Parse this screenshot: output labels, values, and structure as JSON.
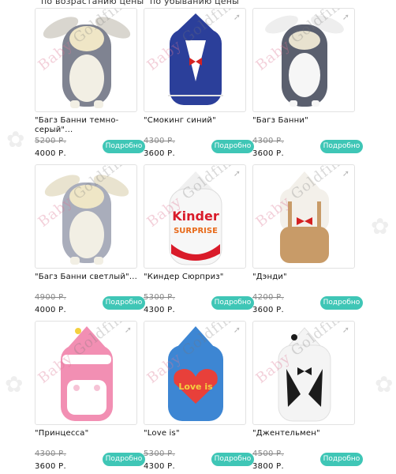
{
  "sort": {
    "ascending": "по возрастанию цены",
    "descending": "по убыванию цены"
  },
  "watermark": {
    "part1": "Baby",
    "part2": "Goldfinch"
  },
  "button_label": "Подробно",
  "products": [
    {
      "title": "\"Багз Банни темно-серый\"...",
      "old_price": "5200 Р.",
      "price": "4000 Р.",
      "colors": {
        "body": "#7f8391",
        "accent": "#f2efe4"
      }
    },
    {
      "title": "\"Смокинг синий\"",
      "old_price": "4300 Р.",
      "price": "3600 Р.",
      "colors": {
        "body": "#2b3f9a",
        "accent": "#ffffff"
      }
    },
    {
      "title": "\"Багз Банни\"",
      "old_price": "4300 Р.",
      "price": "3600 Р.",
      "colors": {
        "body": "#5a5f6e",
        "accent": "#f6f6f6"
      }
    },
    {
      "title": "\"Багз Банни светлый\"...",
      "old_price": "4900 Р.",
      "price": "4000 Р.",
      "colors": {
        "body": "#a9adbb",
        "accent": "#f2efe4"
      }
    },
    {
      "title": "\"Киндер Сюрприз\"",
      "old_price": "5300 Р.",
      "price": "4300 Р.",
      "colors": {
        "body": "#f7f7f7",
        "accent": "#d91b2a"
      }
    },
    {
      "title": "\"Дэнди\"",
      "old_price": "4200 Р.",
      "price": "3600 Р.",
      "colors": {
        "body": "#c89b68",
        "accent": "#f3f0ea"
      }
    },
    {
      "title": "\"Принцесса\"",
      "old_price": "4300 Р.",
      "price": "3600 Р.",
      "colors": {
        "body": "#f28fb3",
        "accent": "#ffffff"
      }
    },
    {
      "title": "\"Love is\"",
      "old_price": "5300 Р.",
      "price": "4300 Р.",
      "colors": {
        "body": "#3d86d3",
        "accent": "#e8403a"
      }
    },
    {
      "title": "\"Джентельмен\"",
      "old_price": "4500 Р.",
      "price": "3800 Р.",
      "colors": {
        "body": "#f4f4f4",
        "accent": "#1b1b1b"
      }
    }
  ],
  "icons": {
    "arrow": "arrow-icon"
  }
}
